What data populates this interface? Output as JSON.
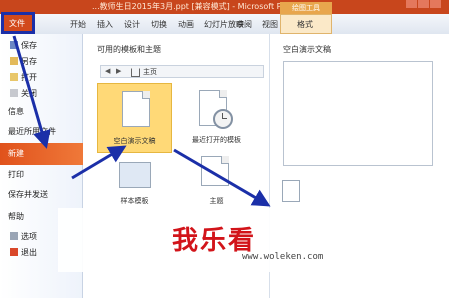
{
  "titlebar": {
    "title": "...教师生日2015年3月.ppt [兼容模式] - Microsoft Po...",
    "contextual_tab": "绘图工具"
  },
  "tabs": {
    "file": "文件",
    "items": [
      "开始",
      "插入",
      "设计",
      "切换",
      "动画",
      "幻灯片放映",
      "审阅",
      "视图"
    ],
    "format": "格式"
  },
  "nav": {
    "save": "保存",
    "save_as": "另存",
    "open": "打开",
    "close": "关闭",
    "info": "信息",
    "recent": "最近所用文件",
    "new": "新建",
    "print": "打印",
    "save_send": "保存并发送",
    "help": "帮助",
    "options": "选项",
    "exit": "退出"
  },
  "main": {
    "section_title": "可用的模板和主题",
    "breadcrumb_home": "主页",
    "tiles": {
      "blank": "空白演示文稿",
      "recent_templates": "最近打开的模板",
      "sample_templates": "样本模板",
      "themes": "主题"
    }
  },
  "preview": {
    "title": "空白演示文稿"
  },
  "watermark": {
    "logo": "我乐看",
    "url": "www.woleken.com"
  },
  "colors": {
    "accent": "#d24a1c",
    "annotation": "#1b2fa8",
    "selected_tile": "#ffd977",
    "watermark": "#d2141a"
  }
}
